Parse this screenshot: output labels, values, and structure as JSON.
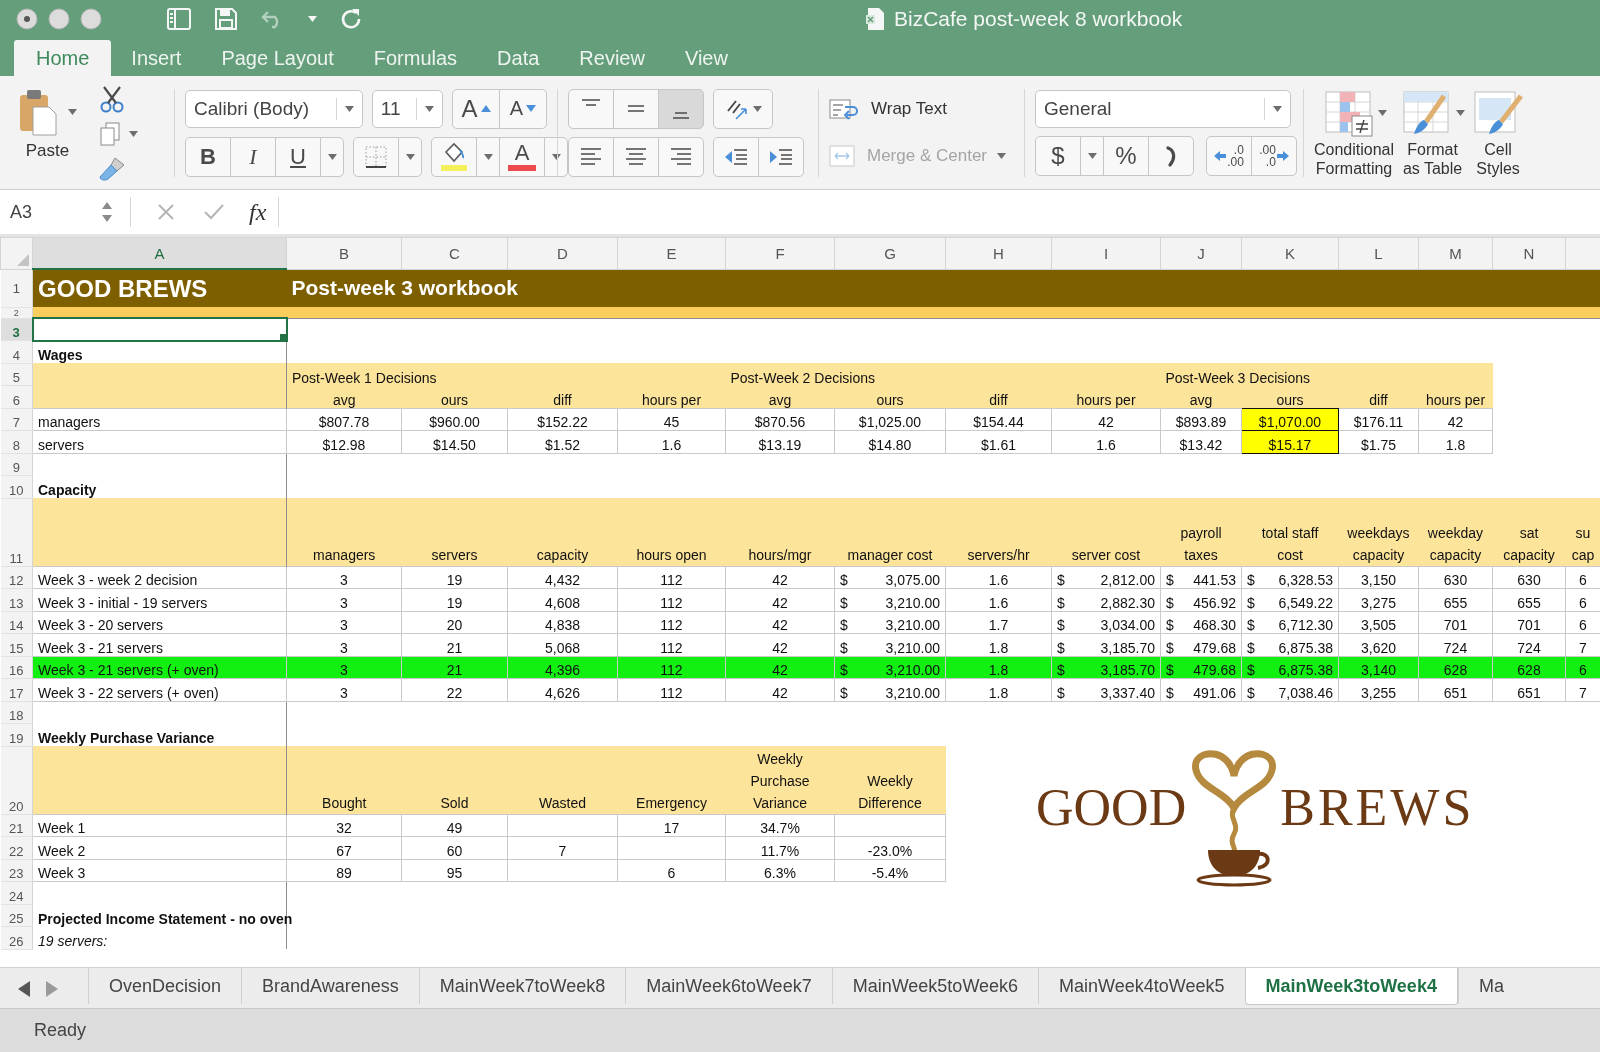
{
  "window": {
    "title": "BizCafe post-week 8 workbook"
  },
  "quick_access": {
    "undo": {
      "disabled": true
    }
  },
  "ribbon_tabs": [
    {
      "label": "Home",
      "selected": true
    },
    {
      "label": "Insert",
      "selected": false
    },
    {
      "label": "Page Layout",
      "selected": false
    },
    {
      "label": "Formulas",
      "selected": false
    },
    {
      "label": "Data",
      "selected": false
    },
    {
      "label": "Review",
      "selected": false
    },
    {
      "label": "View",
      "selected": false
    }
  ],
  "ribbon": {
    "paste": "Paste",
    "font_name": "Calibri (Body)",
    "font_size": "11",
    "grow_font": "A",
    "shrink_font": "A",
    "bold": "B",
    "italic": "I",
    "underline": "U",
    "font_color": "A",
    "vertical_align": [
      {
        "kind": "top",
        "selected": false
      },
      {
        "kind": "middle",
        "selected": false
      },
      {
        "kind": "bottom",
        "selected": true
      }
    ],
    "horizontal_align": [
      {
        "kind": "left",
        "selected": false
      },
      {
        "kind": "center",
        "selected": false
      },
      {
        "kind": "right",
        "selected": false
      }
    ],
    "wrap_text": "Wrap Text",
    "merge_center": {
      "label": "Merge & Center",
      "disabled": true
    },
    "number_format": "General",
    "currency": "$",
    "percent": "%",
    "increase_decimal": {
      "top": ".0",
      "bottom": ".00"
    },
    "decrease_decimal": {
      "top": ".00",
      "bottom": ".0"
    },
    "conditional_formatting": "Conditional\nFormatting",
    "format_as_table": "Format\nas Table",
    "cell_styles": "Cell\nStyles"
  },
  "formula_bar": {
    "name_box": "A3",
    "function_label": "fx"
  },
  "sheet": {
    "column_headers": [
      {
        "label": "A",
        "selected": true
      },
      {
        "label": "B",
        "selected": false
      },
      {
        "label": "C",
        "selected": false
      },
      {
        "label": "D",
        "selected": false
      },
      {
        "label": "E",
        "selected": false
      },
      {
        "label": "F",
        "selected": false
      },
      {
        "label": "G",
        "selected": false
      },
      {
        "label": "H",
        "selected": false
      },
      {
        "label": "I",
        "selected": false
      },
      {
        "label": "J",
        "selected": false
      },
      {
        "label": "K",
        "selected": false
      },
      {
        "label": "L",
        "selected": false
      },
      {
        "label": "M",
        "selected": false
      },
      {
        "label": "N",
        "selected": false
      }
    ],
    "rows": [
      {
        "n": "1",
        "kind": "banner",
        "selected": false,
        "cells": [
          "GOOD BREWS",
          "Post-week 3 workbook"
        ]
      },
      {
        "n": "2",
        "kind": "band",
        "selected": false
      },
      {
        "n": "3",
        "kind": "blank",
        "selected": true
      },
      {
        "n": "4",
        "kind": "section",
        "selected": false,
        "cells": [
          "Wages"
        ]
      },
      {
        "n": "5",
        "kind": "group_heading",
        "selected": false,
        "cells": [
          null,
          "Post-Week 1 Decisions",
          null,
          null,
          null,
          "Post-Week 2 Decisions",
          null,
          null,
          null,
          "Post-Week 3 Decisions",
          null,
          null,
          null
        ]
      },
      {
        "n": "6",
        "kind": "column_heading",
        "selected": false,
        "cells": [
          null,
          "avg",
          "ours",
          "diff",
          "hours per",
          "avg",
          "ours",
          "diff",
          "hours per",
          "avg",
          "ours",
          "diff",
          "hours per"
        ]
      },
      {
        "n": "7",
        "kind": "data",
        "selected": false,
        "highlighted": false,
        "cells": [
          "managers",
          "$807.78",
          "$960.00",
          "$152.22",
          "45",
          "$870.56",
          "$1,025.00",
          "$154.44",
          "42",
          "$893.89",
          {
            "text": "$1,070.00",
            "highlighted": true
          },
          "$176.11",
          "42"
        ]
      },
      {
        "n": "8",
        "kind": "data",
        "selected": false,
        "highlighted": false,
        "cells": [
          "servers",
          "$12.98",
          "$14.50",
          "$1.52",
          "1.6",
          "$13.19",
          "$14.80",
          "$1.61",
          "1.6",
          "$13.42",
          {
            "text": "$15.17",
            "highlighted": true
          },
          "$1.75",
          "1.8"
        ]
      },
      {
        "n": "9",
        "kind": "blank",
        "selected": false
      },
      {
        "n": "10",
        "kind": "section",
        "selected": false,
        "cells": [
          "Capacity"
        ]
      },
      {
        "n": "11",
        "kind": "wrapped_heading",
        "selected": false,
        "cells": [
          null,
          "managers",
          "servers",
          "capacity",
          "hours open",
          "hours/mgr",
          "manager cost",
          "servers/hr",
          "server cost",
          "payroll\ntaxes",
          "total staff\ncost",
          "weekdays\ncapacity",
          "weekday\ncapacity",
          "sat\ncapacity",
          "su\ncap"
        ]
      },
      {
        "n": "12",
        "kind": "data",
        "selected": false,
        "highlighted": false,
        "cells": [
          "Week 3 - week 2 decision",
          "3",
          "19",
          "4,432",
          "112",
          "42",
          {
            "currency": "$",
            "amount": "3,075.00"
          },
          "1.6",
          {
            "currency": "$",
            "amount": "2,812.00"
          },
          {
            "currency": "$",
            "amount": "441.53"
          },
          {
            "currency": "$",
            "amount": "6,328.53"
          },
          "3,150",
          "630",
          "630",
          "6"
        ]
      },
      {
        "n": "13",
        "kind": "data",
        "selected": false,
        "highlighted": false,
        "cells": [
          "Week 3 - initial - 19 servers",
          "3",
          "19",
          "4,608",
          "112",
          "42",
          {
            "currency": "$",
            "amount": "3,210.00"
          },
          "1.6",
          {
            "currency": "$",
            "amount": "2,882.30"
          },
          {
            "currency": "$",
            "amount": "456.92"
          },
          {
            "currency": "$",
            "amount": "6,549.22"
          },
          "3,275",
          "655",
          "655",
          "6"
        ]
      },
      {
        "n": "14",
        "kind": "data",
        "selected": false,
        "highlighted": false,
        "cells": [
          "Week 3 - 20 servers",
          "3",
          "20",
          "4,838",
          "112",
          "42",
          {
            "currency": "$",
            "amount": "3,210.00"
          },
          "1.7",
          {
            "currency": "$",
            "amount": "3,034.00"
          },
          {
            "currency": "$",
            "amount": "468.30"
          },
          {
            "currency": "$",
            "amount": "6,712.30"
          },
          "3,505",
          "701",
          "701",
          "6"
        ]
      },
      {
        "n": "15",
        "kind": "data",
        "selected": false,
        "highlighted": false,
        "cells": [
          "Week 3 - 21 servers",
          "3",
          "21",
          "5,068",
          "112",
          "42",
          {
            "currency": "$",
            "amount": "3,210.00"
          },
          "1.8",
          {
            "currency": "$",
            "amount": "3,185.70"
          },
          {
            "currency": "$",
            "amount": "479.68"
          },
          {
            "currency": "$",
            "amount": "6,875.38"
          },
          "3,620",
          "724",
          "724",
          "7"
        ]
      },
      {
        "n": "16",
        "kind": "data",
        "selected": false,
        "highlighted": true,
        "cells": [
          "Week 3 - 21 servers (+ oven)",
          "3",
          "21",
          "4,396",
          "112",
          "42",
          {
            "currency": "$",
            "amount": "3,210.00"
          },
          "1.8",
          {
            "currency": "$",
            "amount": "3,185.70"
          },
          {
            "currency": "$",
            "amount": "479.68"
          },
          {
            "currency": "$",
            "amount": "6,875.38"
          },
          "3,140",
          "628",
          "628",
          "6"
        ]
      },
      {
        "n": "17",
        "kind": "data",
        "selected": false,
        "highlighted": false,
        "cells": [
          "Week 3 - 22 servers (+ oven)",
          "3",
          "22",
          "4,626",
          "112",
          "42",
          {
            "currency": "$",
            "amount": "3,210.00"
          },
          "1.8",
          {
            "currency": "$",
            "amount": "3,337.40"
          },
          {
            "currency": "$",
            "amount": "491.06"
          },
          {
            "currency": "$",
            "amount": "7,038.46"
          },
          "3,255",
          "651",
          "651",
          "7"
        ]
      },
      {
        "n": "18",
        "kind": "blank",
        "selected": false
      },
      {
        "n": "19",
        "kind": "section",
        "selected": false,
        "cells": [
          "Weekly Purchase Variance"
        ]
      },
      {
        "n": "20",
        "kind": "wrapped_heading",
        "selected": false,
        "cells": [
          null,
          "Bought",
          "Sold",
          "Wasted",
          "Emergency",
          "Weekly\nPurchase\nVariance",
          "Weekly\nDifference"
        ]
      },
      {
        "n": "21",
        "kind": "data",
        "selected": false,
        "highlighted": false,
        "cells": [
          "Week 1",
          "32",
          "49",
          null,
          "17",
          "34.7%",
          null
        ]
      },
      {
        "n": "22",
        "kind": "data",
        "selected": false,
        "highlighted": false,
        "cells": [
          "Week 2",
          "67",
          "60",
          "7",
          null,
          "11.7%",
          "-23.0%"
        ]
      },
      {
        "n": "23",
        "kind": "data",
        "selected": false,
        "highlighted": false,
        "cells": [
          "Week 3",
          "89",
          "95",
          null,
          "6",
          "6.3%",
          "-5.4%"
        ]
      },
      {
        "n": "24",
        "kind": "blank",
        "selected": false
      },
      {
        "n": "25",
        "kind": "section",
        "selected": false,
        "cells": [
          "Projected Income Statement - no oven"
        ]
      },
      {
        "n": "26",
        "kind": "note",
        "selected": false,
        "cells": [
          "19 servers:"
        ]
      }
    ],
    "logo": {
      "left": "GOOD",
      "right": "BREWS"
    }
  },
  "sheet_tabs": [
    {
      "label": "OvenDecision",
      "selected": false
    },
    {
      "label": "BrandAwareness",
      "selected": false
    },
    {
      "label": "MainWeek7toWeek8",
      "selected": false
    },
    {
      "label": "MainWeek6toWeek7",
      "selected": false
    },
    {
      "label": "MainWeek5toWeek6",
      "selected": false
    },
    {
      "label": "MainWeek4toWeek5",
      "selected": false
    },
    {
      "label": "MainWeek3toWeek4",
      "selected": true
    },
    {
      "label": "Ma",
      "selected": false
    }
  ],
  "status_bar": {
    "text": "Ready"
  }
}
